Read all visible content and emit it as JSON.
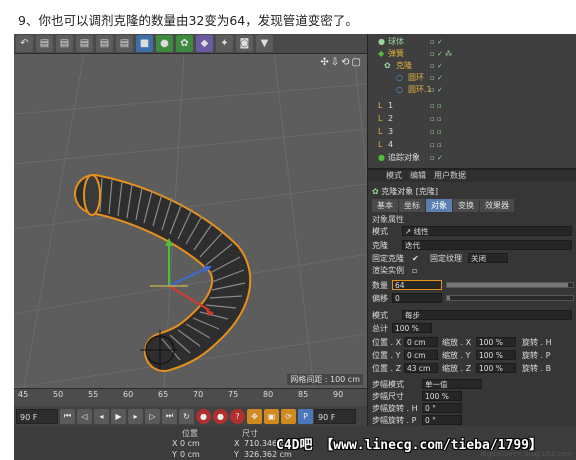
{
  "caption": "9、你也可以调剂克隆的数量由32变为64，发现管道变密了。",
  "toolbar": {
    "icons": [
      "undo-icon",
      "film-icon",
      "cube-icon",
      "sphere-icon",
      "deformer-icon",
      "camera-icon"
    ]
  },
  "viewport": {
    "nav_icons": "✣⇩⟲▢",
    "grid_label": "网格间距 : 100 cm"
  },
  "timeline": {
    "ticks": [
      "45",
      "50",
      "55",
      "60",
      "65",
      "70",
      "75",
      "80",
      "85",
      "90"
    ],
    "current_frame": "90 F",
    "end_frame": "90 F"
  },
  "coords": {
    "headers": [
      "位置",
      "尺寸"
    ],
    "x_pos": "0 cm",
    "x_size": "710.346 c",
    "y_pos": "0 cm",
    "y_size": "326.362 cm"
  },
  "watermark": "C4D吧 【www.linecg.com/tieba/1799】",
  "site_mark": "digitallinren.blog.163.com",
  "objects": [
    {
      "name": "球体",
      "color": "#9ad39a",
      "indent": 6
    },
    {
      "name": "弹簧",
      "color": "#e0b040",
      "indent": 6
    },
    {
      "name": "克隆",
      "color": "#e0b040",
      "indent": 12
    },
    {
      "name": "圆环",
      "color": "#e0b040",
      "indent": 24
    },
    {
      "name": "圆环.1",
      "color": "#e0b040",
      "indent": 24
    },
    {
      "name": "1",
      "color": "#dddddd",
      "indent": 6
    },
    {
      "name": "2",
      "color": "#dddddd",
      "indent": 6
    },
    {
      "name": "3",
      "color": "#dddddd",
      "indent": 6
    },
    {
      "name": "4",
      "color": "#dddddd",
      "indent": 6
    },
    {
      "name": "追踪对象",
      "color": "#dddddd",
      "indent": 6
    }
  ],
  "attr": {
    "menu": [
      "模式",
      "编辑",
      "用户数据"
    ],
    "title": "克隆对象 [克隆]",
    "tabs": [
      "基本",
      "坐标",
      "对象",
      "变换",
      "效果器"
    ],
    "active_tab": 2,
    "section": "对象属性",
    "mode_label": "模式",
    "mode_value": "↗ 线性",
    "clone_label": "克隆",
    "clone_value": "迭代",
    "fixed_clone_label": "固定克隆",
    "fixed_texture_label": "固定纹理",
    "fixed_texture_value": "关闭",
    "render_instance_label": "渲染实例",
    "count_label": "数量",
    "count_value": "64",
    "count_fraction": 0.96,
    "offset_label": "偏移",
    "offset_value": "0",
    "offset_fraction": 0.02,
    "mode2_label": "模式",
    "mode2_value": "每步",
    "total_label": "总计",
    "total_value": "100 %",
    "pos_x_label": "位置 . X",
    "pos_x_value": "0 cm",
    "pos_y_label": "位置 . Y",
    "pos_y_value": "0 cm",
    "pos_z_label": "位置 . Z",
    "pos_z_value": "43 cm",
    "scale_x_label": "缩放 . X",
    "scale_x_value": "100 %",
    "scale_y_label": "缩放 . Y",
    "scale_y_value": "100 %",
    "scale_z_label": "缩放 . Z",
    "scale_z_value": "100 %",
    "rot_h_label": "旋转 . H",
    "rot_p_label": "旋转 . P",
    "rot_b_label": "旋转 . B",
    "step_mode_label": "步幅模式",
    "step_mode_value": "单一值",
    "step_size_label": "步幅尺寸",
    "step_size_value": "100 %",
    "step_rot_h_label": "步幅旋转 . H",
    "step_rot_h_value": "0 °",
    "step_rot_p_label": "步幅旋转 . P",
    "step_rot_p_value": "0 °",
    "step_rot_b_label": "步幅旋转 . B",
    "step_rot_b_value": "0 °"
  },
  "colors": {
    "selection_orange": "#e8901c",
    "axis_x": "#d83a2a",
    "axis_y": "#4fbf3a",
    "axis_z": "#3a6ad8",
    "active_tab": "#5b7fb0"
  }
}
